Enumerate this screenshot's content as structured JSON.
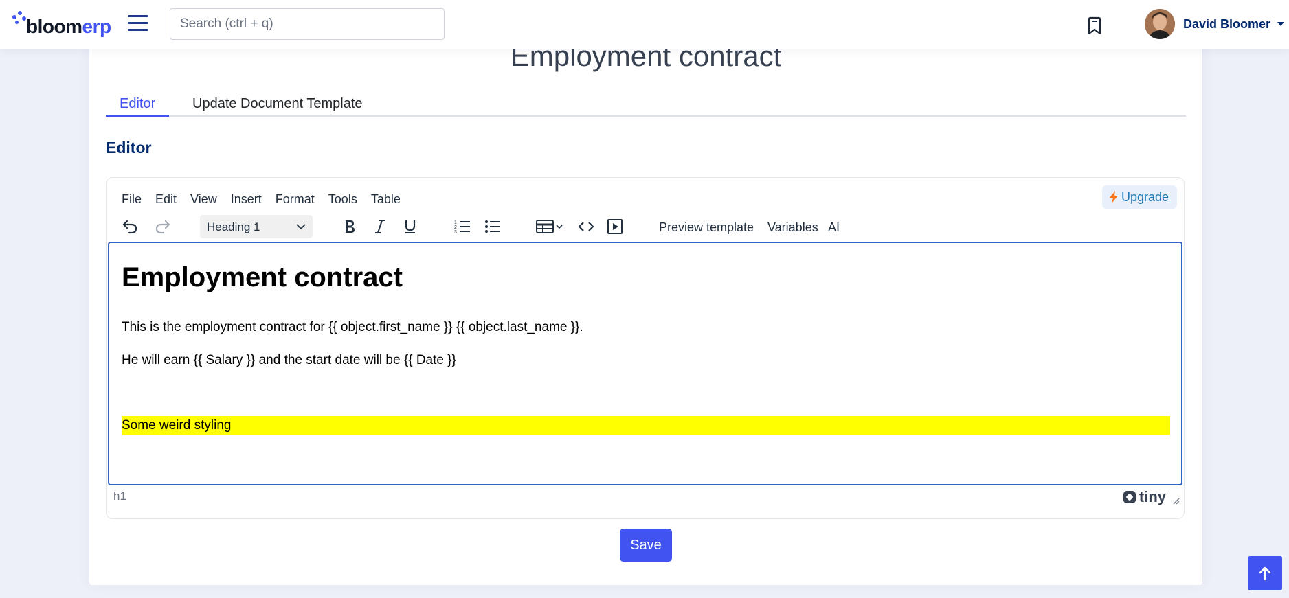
{
  "brand": {
    "name_part1": "bloom",
    "name_part2": "erp",
    "accent_color": "#4154f1"
  },
  "header": {
    "search_placeholder": "Search (ctrl + q)",
    "user_name": "David Bloomer"
  },
  "page": {
    "title": "Employment contract",
    "tabs": [
      {
        "label": "Editor",
        "active": true
      },
      {
        "label": "Update Document Template",
        "active": false
      }
    ],
    "section_title": "Editor"
  },
  "editor": {
    "menu": [
      "File",
      "Edit",
      "View",
      "Insert",
      "Format",
      "Tools",
      "Table"
    ],
    "upgrade_label": "Upgrade",
    "block_format": "Heading 1",
    "toolbar_text_buttons": [
      "Preview template",
      "Variables",
      "AI"
    ],
    "icons": [
      "undo-icon",
      "redo-icon",
      "bold-icon",
      "italic-icon",
      "underline-icon",
      "numbered-list-icon",
      "bullet-list-icon",
      "table-icon",
      "code-icon",
      "media-icon"
    ],
    "content": {
      "heading": "Employment contract",
      "paragraph1": "This is the employment contract for {{ object.first_name }} {{ object.last_name }}.",
      "paragraph2": "He will earn {{ Salary }} and the start date will be {{ Date }}",
      "highlighted": "Some weird styling",
      "highlight_color": "#ffff00"
    },
    "status_path": "h1",
    "powered_by": "tiny"
  },
  "actions": {
    "save_label": "Save"
  }
}
